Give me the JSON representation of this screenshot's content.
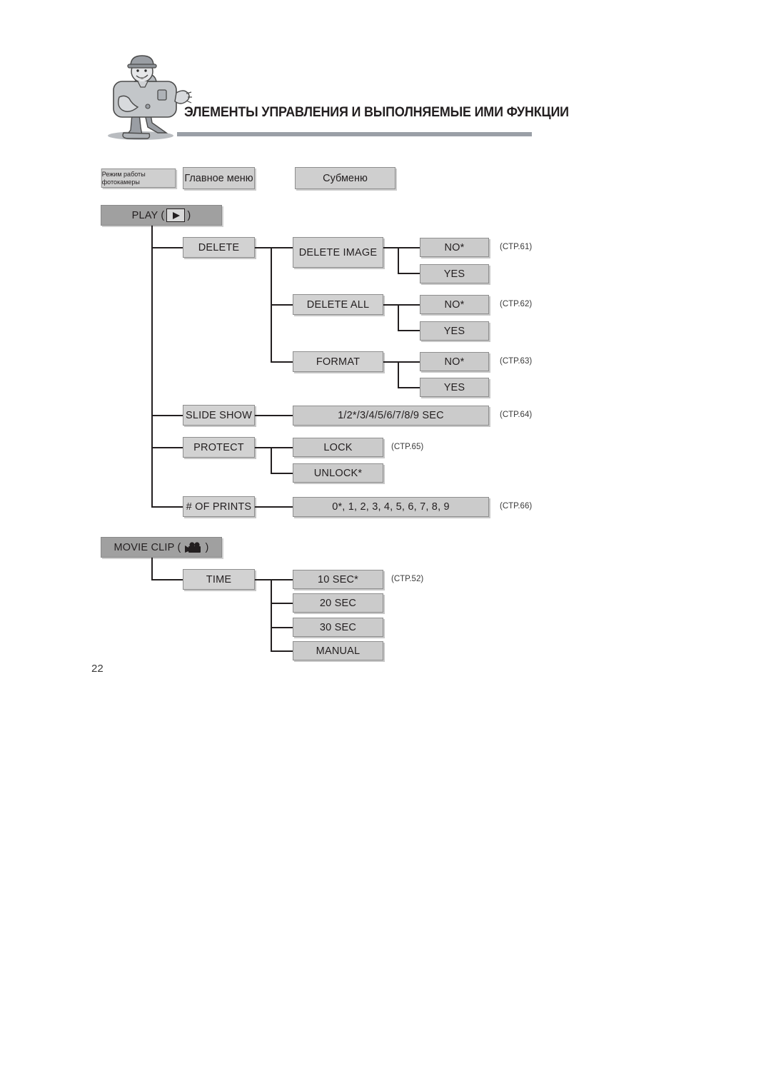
{
  "header": {
    "title": "ЭЛЕМЕНТЫ УПРАВЛЕНИЯ И ВЫПОЛНЯЕМЫЕ ИМИ ФУНКЦИИ",
    "mascot_icon": "camera-mascot-icon",
    "rule_color": "#9a9fa6"
  },
  "legend": {
    "mode_label": "Режим работы фотокамеры",
    "main_menu_label": "Главное меню",
    "submenu_label": "Субменю"
  },
  "page_number": "22",
  "colors": {
    "mode_box": "#a0a0a0",
    "menu_box": "#d2d2d2",
    "sub_box": "#cbcbcb",
    "line": "#231f20"
  },
  "tree": {
    "play": {
      "label": "PLAY (",
      "label_tail": ")",
      "icon": "play-triangle-icon",
      "items": [
        {
          "label": "DELETE",
          "children": [
            {
              "label": "DELETE IMAGE",
              "ref": "(CTP.61)",
              "options": [
                {
                  "label": "NO*"
                },
                {
                  "label": "YES"
                }
              ]
            },
            {
              "label": "DELETE ALL",
              "ref": "(CTP.62)",
              "options": [
                {
                  "label": "NO*"
                },
                {
                  "label": "YES"
                }
              ]
            },
            {
              "label": "FORMAT",
              "ref": "(CTP.63)",
              "options": [
                {
                  "label": "NO*"
                },
                {
                  "label": "YES"
                }
              ]
            }
          ]
        },
        {
          "label": "SLIDE SHOW",
          "ref": "(CTP.64)",
          "value": "1/2*/3/4/5/6/7/8/9 SEC"
        },
        {
          "label": "PROTECT",
          "ref": "(CTP.65)",
          "options": [
            {
              "label": "LOCK"
            },
            {
              "label": "UNLOCK*"
            }
          ]
        },
        {
          "label": "# OF PRINTS",
          "ref": "(CTP.66)",
          "value": "0*, 1, 2, 3, 4, 5, 6, 7, 8, 9"
        }
      ]
    },
    "movie_clip": {
      "label": "MOVIE CLIP (",
      "label_tail": ")",
      "icon": "movie-camera-icon",
      "items": [
        {
          "label": "TIME",
          "ref": "(CTP.52)",
          "options": [
            {
              "label": "10 SEC*"
            },
            {
              "label": "20 SEC"
            },
            {
              "label": "30 SEC"
            },
            {
              "label": "MANUAL"
            }
          ]
        }
      ]
    }
  }
}
